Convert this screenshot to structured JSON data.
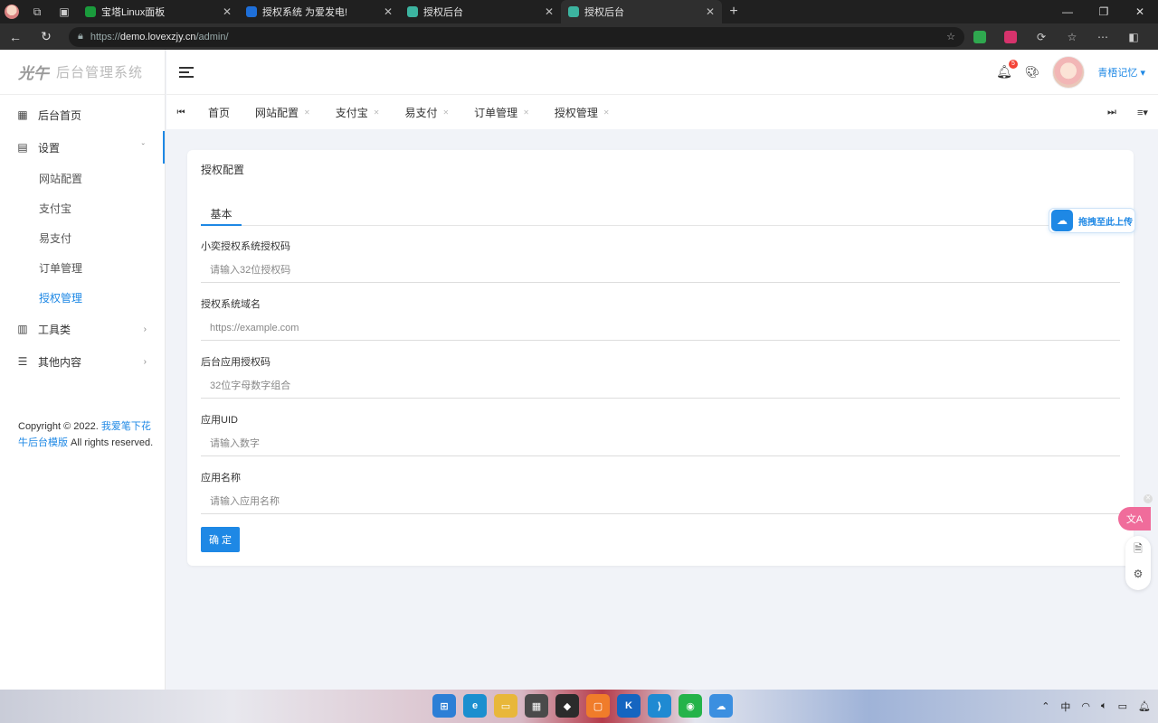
{
  "browser": {
    "tabs": [
      {
        "title": "宝塔Linux面板",
        "favicon_color": "#1a9b3c",
        "active": false
      },
      {
        "title": "授权系统 为爱发电!",
        "favicon_color": "#1e6fd9",
        "active": false
      },
      {
        "title": "授权后台",
        "favicon_color": "#3cb4a0",
        "active": false
      },
      {
        "title": "授权后台",
        "favicon_color": "#3cb4a0",
        "active": true
      }
    ],
    "new_tab": "+",
    "url_prefix": "https://",
    "url_host": "demo.lovexzjy.cn",
    "url_path": "/admin/",
    "window_controls": [
      "—",
      "❐",
      "✕"
    ]
  },
  "sidebar": {
    "logo": "光午",
    "brand_name": "后台管理系统",
    "menu": [
      {
        "label": "后台首页",
        "icon": "dashboard-icon"
      },
      {
        "label": "设置",
        "icon": "settings-icon",
        "arrow": "ˇ"
      },
      {
        "label": "工具类",
        "icon": "book-icon",
        "arrow": "›"
      },
      {
        "label": "其他内容",
        "icon": "list-icon",
        "arrow": "›"
      }
    ],
    "submenu": [
      "网站配置",
      "支付宝",
      "易支付",
      "订单管理",
      "授权管理"
    ],
    "active_sub": "授权管理",
    "copyright_pre": "Copyright © 2022. ",
    "copyright_link": "我爱笔下花 牛后台模版",
    "copyright_post": " All rights reserved."
  },
  "topbar": {
    "notification_count": "5",
    "username": "青梧记忆"
  },
  "tags": {
    "items": [
      "首页",
      "网站配置",
      "支付宝",
      "易支付",
      "订单管理",
      "授权管理"
    ],
    "first_nav": "⏮",
    "last_nav": "⏭",
    "menu_label": "≡▾"
  },
  "card": {
    "title": "授权配置",
    "tab": "基本",
    "fields": [
      {
        "label": "小奕授权系统授权码",
        "placeholder": "请输入32位授权码"
      },
      {
        "label": "授权系统域名",
        "placeholder": "https://example.com"
      },
      {
        "label": "后台应用授权码",
        "placeholder": "32位字母数字组合"
      },
      {
        "label": "应用UID",
        "placeholder": "请输入数字"
      },
      {
        "label": "应用名称",
        "placeholder": "请输入应用名称"
      }
    ],
    "submit_label": "确 定"
  },
  "floating": {
    "upload_label": "拖拽至此上传",
    "translate_label": "文A"
  },
  "taskbar": {
    "tray_text": "中"
  }
}
